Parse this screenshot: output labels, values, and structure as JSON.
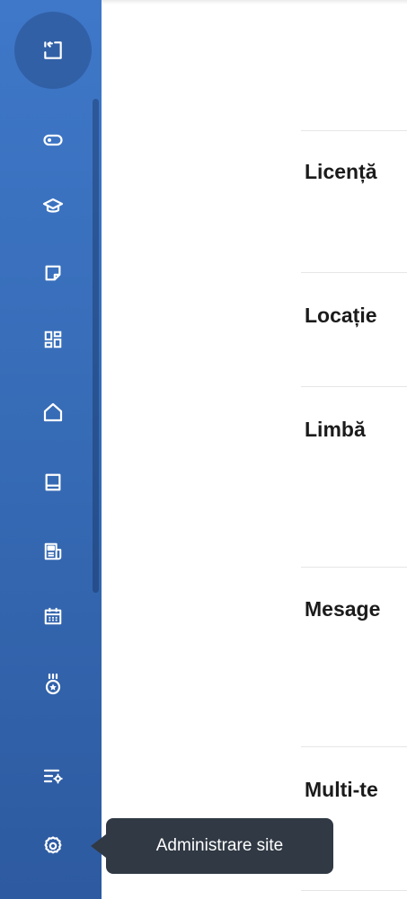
{
  "sidebar": {
    "items": [
      {
        "icon": "exit-app-icon"
      },
      {
        "icon": "toggle-icon"
      },
      {
        "icon": "graduation-cap-icon"
      },
      {
        "icon": "note-icon"
      },
      {
        "icon": "dashboard-grid-icon"
      },
      {
        "icon": "home-icon"
      },
      {
        "icon": "book-icon"
      },
      {
        "icon": "newspaper-icon"
      },
      {
        "icon": "calendar-icon"
      },
      {
        "icon": "medal-icon"
      },
      {
        "icon": "filter-settings-icon"
      },
      {
        "icon": "gear-icon"
      }
    ]
  },
  "main": {
    "sections": [
      {
        "title": "Licență"
      },
      {
        "title": "Locație"
      },
      {
        "title": "Limbă"
      },
      {
        "title": "Mesage"
      },
      {
        "title": "Multi-te"
      }
    ]
  },
  "tooltip": {
    "text": "Administrare site"
  },
  "colors": {
    "sidebar_top": "#3f78c9",
    "sidebar_bottom": "#2d5aa0",
    "tooltip_bg": "#303944"
  }
}
